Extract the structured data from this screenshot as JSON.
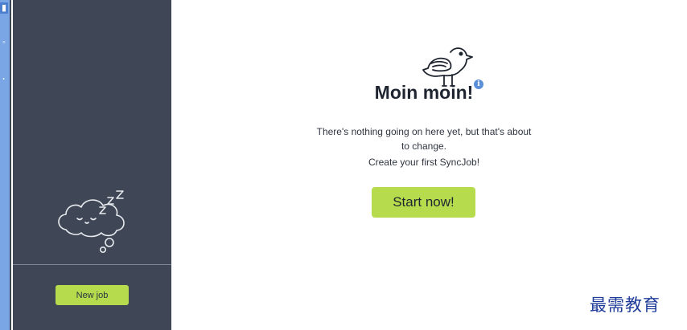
{
  "rail": {
    "icons": [
      "document-icon",
      "sync-icon",
      "settings-icon"
    ]
  },
  "sidebar": {
    "empty_illustration": "sleeping-cloud-icon",
    "new_job_label": "New job"
  },
  "main": {
    "illustration": "seagull-icon",
    "title": "Moin moin!",
    "description": "There's nothing going on here yet, but that's about to change.",
    "subdescription": "Create your first SyncJob!",
    "start_label": "Start now!",
    "info_icon": "info-icon"
  },
  "watermark": {
    "text": "最需教育"
  },
  "colors": {
    "accent_green": "#b6dc4d",
    "sidebar_bg": "#3f4756",
    "rail_bg": "#7aa6e6"
  }
}
